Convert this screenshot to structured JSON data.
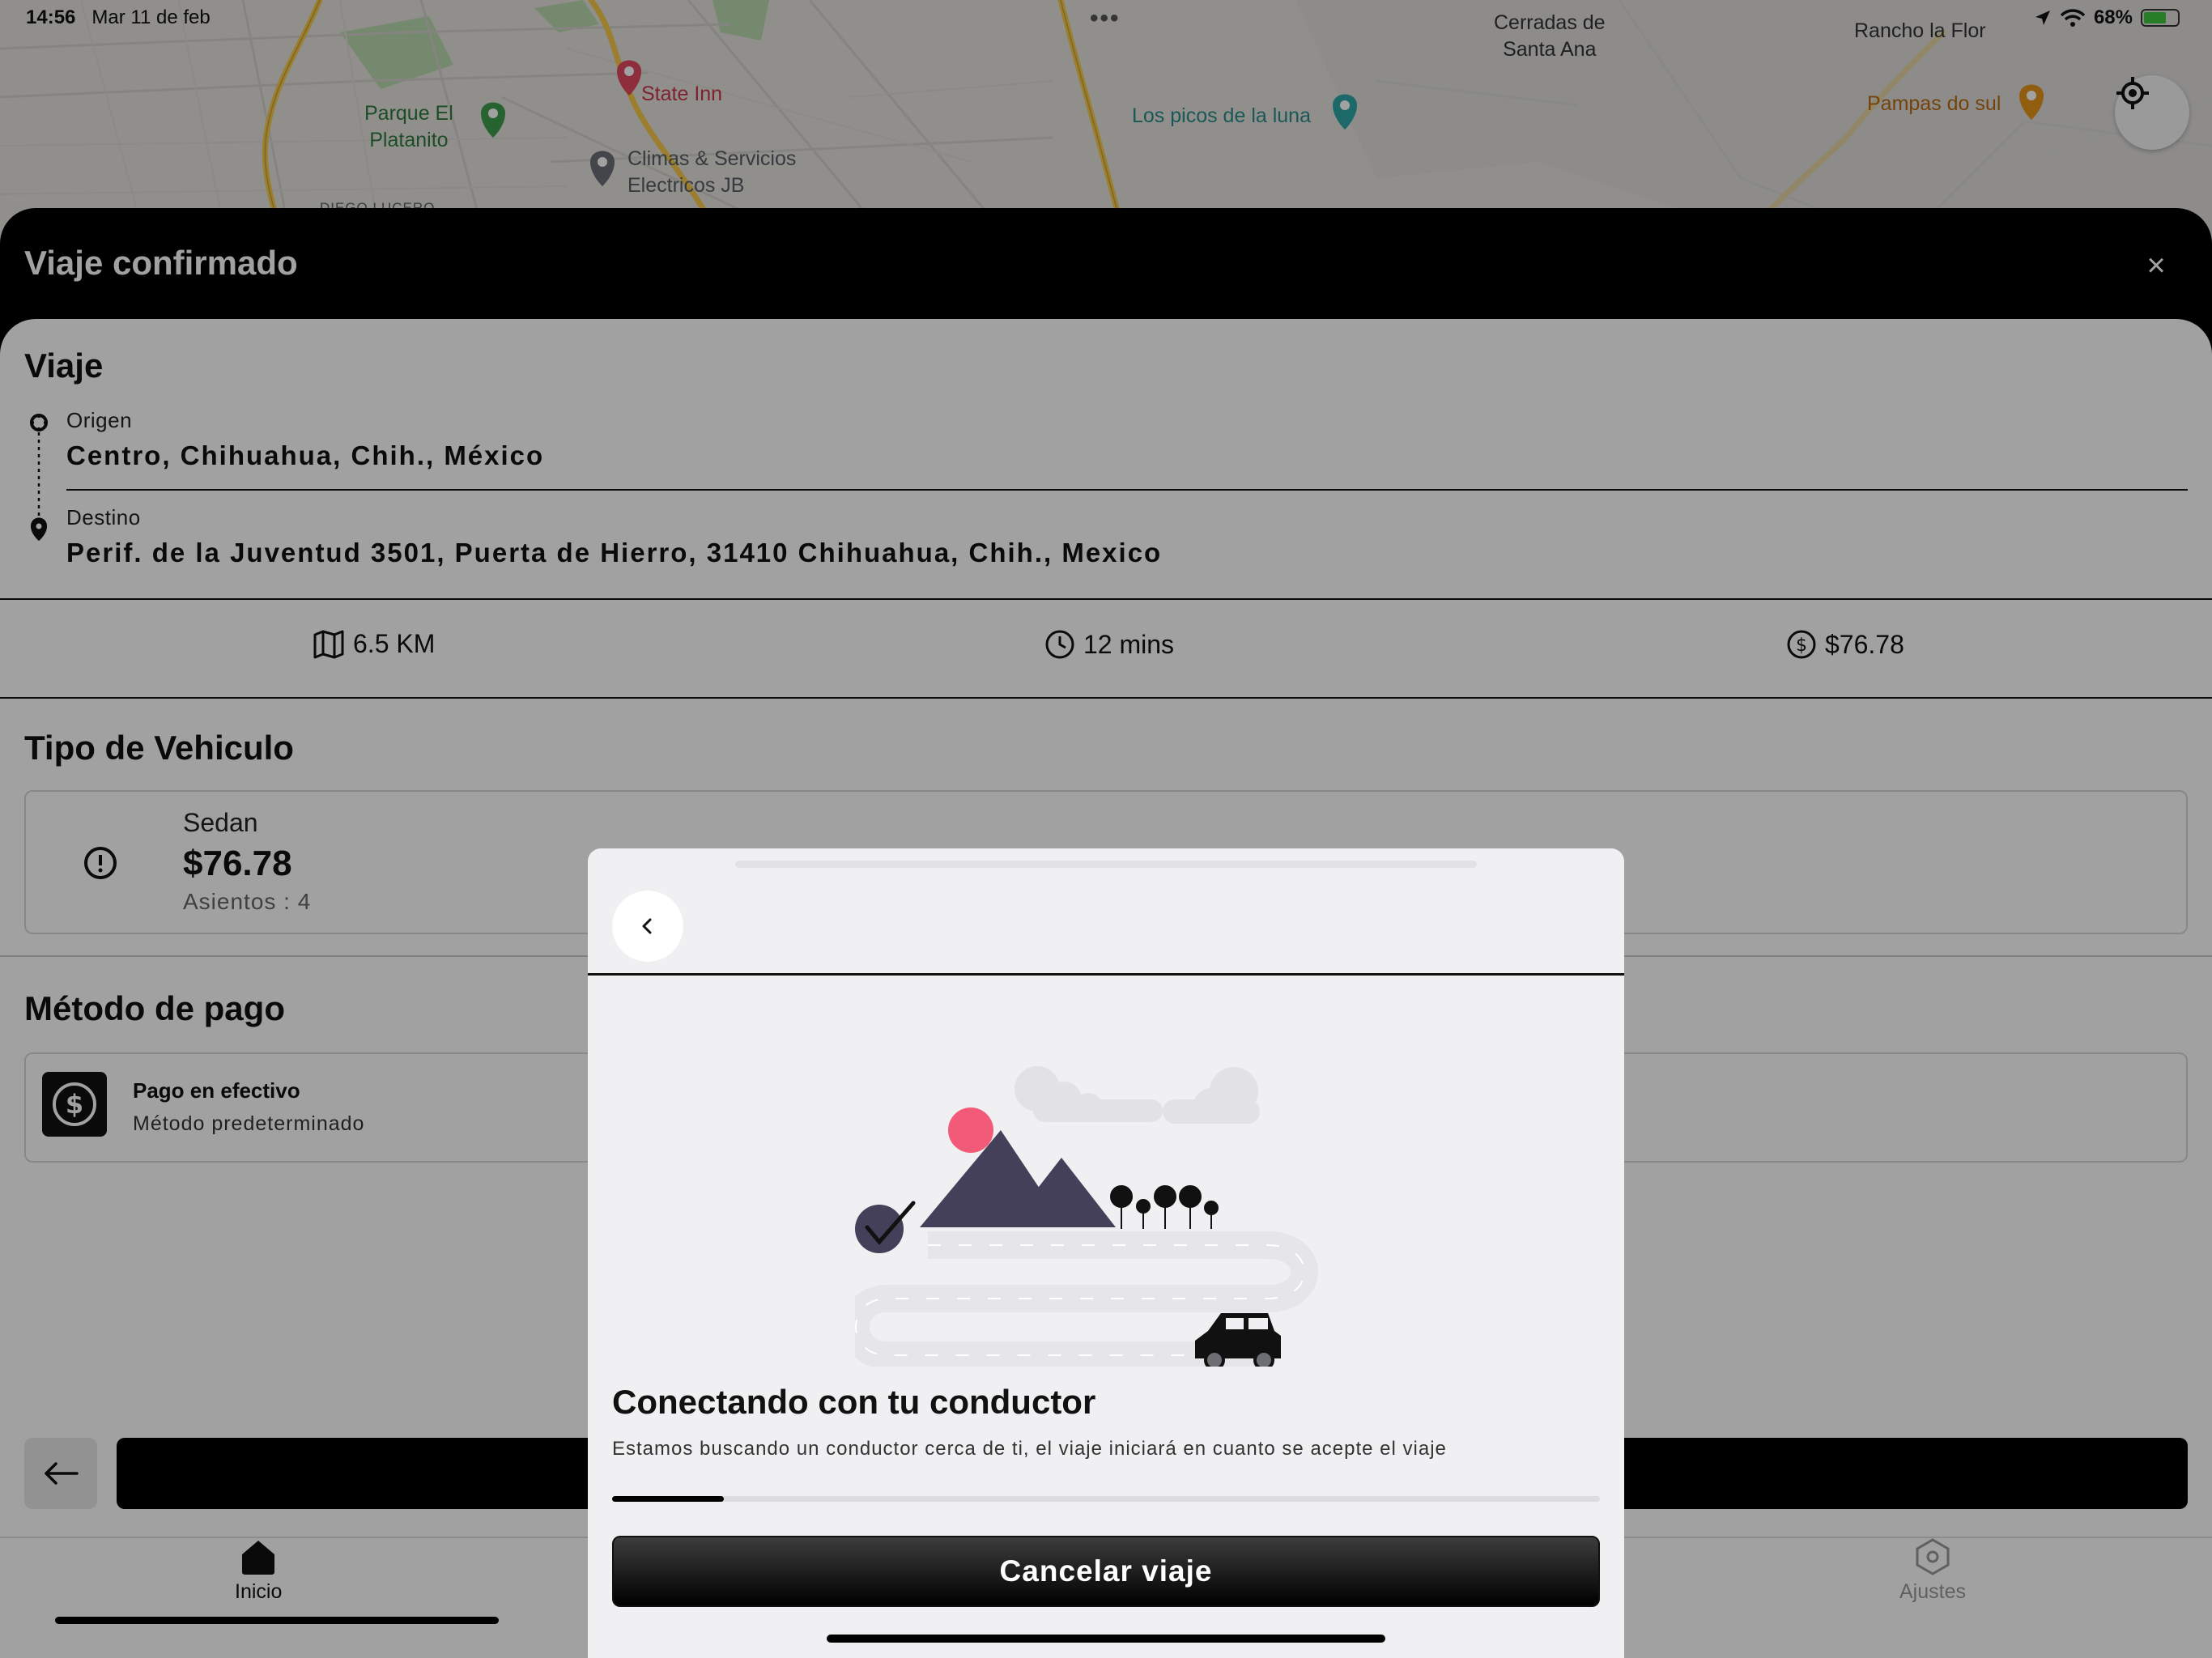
{
  "status_bar": {
    "time": "14:56",
    "date": "Mar 11 de feb",
    "battery": "68%",
    "battery_level": 0.68
  },
  "map": {
    "labels": {
      "parque": "Parque El\nPlatanito",
      "state_inn": "State Inn",
      "climas": "Climas & Servicios\nElectricos JB",
      "diego": "DIEGO LUCERO",
      "picos": "Los picos de la luna",
      "cerradas": "Cerradas de\nSanta Ana",
      "rancho": "Rancho la Flor",
      "pampas": "Pampas do sul"
    }
  },
  "sheet": {
    "title": "Viaje confirmado",
    "close_icon": "×",
    "trip": {
      "heading": "Viaje",
      "origin_label": "Origen",
      "origin_value": "Centro, Chihuahua, Chih., México",
      "destination_label": "Destino",
      "destination_value": "Perif. de la Juventud 3501, Puerta de Hierro, 31410 Chihuahua, Chih., Mexico"
    },
    "stats": {
      "distance": "6.5 KM",
      "time": "12 mins",
      "price": "$76.78"
    },
    "vehicle": {
      "heading": "Tipo de Vehiculo",
      "name": "Sedan",
      "price": "$76.78",
      "seats": "Asientos : 4"
    },
    "payment": {
      "heading": "Método de pago",
      "name": "Pago en efectivo",
      "subtitle": "Método predeterminado"
    }
  },
  "tabbar": {
    "home": "Inicio",
    "settings": "Ajustes"
  },
  "modal": {
    "title": "Conectando con tu conductor",
    "text": "Estamos buscando un conductor cerca de ti, el viaje iniciará en cuanto se acepte el viaje",
    "progress": 0.113,
    "cancel_label": "Cancelar viaje"
  },
  "colors": {
    "accent": "#000000",
    "illustration_mountain": "#45405a",
    "illustration_sun": "#f25b77",
    "map_base": "#e4e2dd"
  }
}
